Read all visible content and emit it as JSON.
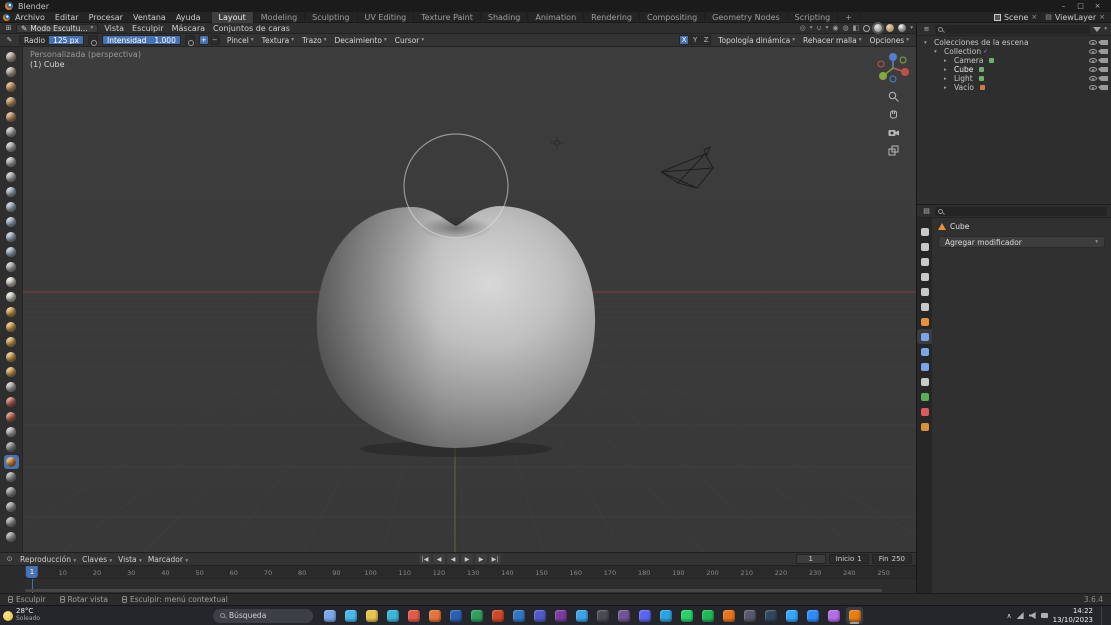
{
  "titlebar": {
    "app_name": "Blender",
    "controls": [
      {
        "n": "minimize",
        "g": "–"
      },
      {
        "n": "maximize",
        "g": "□"
      },
      {
        "n": "close",
        "g": "×"
      }
    ]
  },
  "topbar": {
    "menus": [
      "Archivo",
      "Editar",
      "Procesar",
      "Ventana",
      "Ayuda"
    ],
    "workspaces": [
      "Layout",
      "Modeling",
      "Sculpting",
      "UV Editing",
      "Texture Paint",
      "Shading",
      "Animation",
      "Rendering",
      "Compositing",
      "Geometry Nodes",
      "Scripting",
      "+"
    ],
    "active_workspace_index": 0,
    "scene_label": "Scene",
    "viewlayer_label": "ViewLayer"
  },
  "viewport_header": {
    "mode_label": "Modo Escultu...",
    "menus": [
      "Vista",
      "Esculpir",
      "Máscara",
      "Conjuntos de caras"
    ]
  },
  "tool_settings": {
    "radius_label": "Radio",
    "radius_value": "125 px",
    "strength_label": "Intensidad",
    "strength_value": "1.000",
    "direction_buttons": [
      "+",
      "−"
    ],
    "active_direction_index": 0,
    "dropdowns": [
      "Pincel",
      "Textura",
      "Trazo",
      "Decaimiento",
      "Cursor"
    ],
    "mirror_axes": [
      "X",
      "Y",
      "Z"
    ],
    "active_mirror_index": 0,
    "right_dropdowns": [
      "Topología dinámica",
      "Rehacer malla",
      "Opciones"
    ]
  },
  "viewport": {
    "view_label": "Personalizada (perspectiva)",
    "object_label": "(1) Cube",
    "active_brush_index": 27,
    "brushes": [
      {
        "n": "draw",
        "c": "#c2b6a8"
      },
      {
        "n": "draw-sharp",
        "c": "#bdb2a4"
      },
      {
        "n": "clay",
        "c": "#c79a66"
      },
      {
        "n": "clay-strips",
        "c": "#c79a66"
      },
      {
        "n": "clay-thumb",
        "c": "#c79a66"
      },
      {
        "n": "layer",
        "c": "#b8b8b8"
      },
      {
        "n": "inflate",
        "c": "#b8b8b8"
      },
      {
        "n": "blob",
        "c": "#b8b8b8"
      },
      {
        "n": "crease",
        "c": "#b8b8b8"
      },
      {
        "n": "smooth",
        "c": "#a8b8c8"
      },
      {
        "n": "flatten",
        "c": "#a8b8c8"
      },
      {
        "n": "fill",
        "c": "#a8b8c8"
      },
      {
        "n": "scrape",
        "c": "#a8b8c8"
      },
      {
        "n": "multiplane-scrape",
        "c": "#a8b8c8"
      },
      {
        "n": "pinch",
        "c": "#b8b8b8"
      },
      {
        "n": "grab",
        "c": "#e0dcd4"
      },
      {
        "n": "elastic-deform",
        "c": "#e0dcd4"
      },
      {
        "n": "snake-hook",
        "c": "#d9a758"
      },
      {
        "n": "thumb",
        "c": "#d9a758"
      },
      {
        "n": "pose",
        "c": "#d9a758"
      },
      {
        "n": "nudge",
        "c": "#d9a758"
      },
      {
        "n": "rotate",
        "c": "#d9a758"
      },
      {
        "n": "slide-relax",
        "c": "#b8b8b8"
      },
      {
        "n": "boundary",
        "c": "#c06a5a"
      },
      {
        "n": "cloth",
        "c": "#c06a5a"
      },
      {
        "n": "simplify",
        "c": "#b8b8b8"
      },
      {
        "n": "mask",
        "c": "#8f8f8f"
      },
      {
        "n": "draw-face-sets",
        "c": "#d98e3a"
      },
      {
        "n": "box-hide",
        "c": "#9f9f9f"
      },
      {
        "n": "box-mask",
        "c": "#9f9f9f"
      },
      {
        "n": "lasso-mask",
        "c": "#9f9f9f"
      },
      {
        "n": "line-project",
        "c": "#9f9f9f"
      },
      {
        "n": "mesh-filter",
        "c": "#9f9f9f"
      }
    ]
  },
  "outliner": {
    "rows": [
      {
        "label": "Colecciones de la escena",
        "icon": "scene",
        "depth": 0,
        "arrow": "▾"
      },
      {
        "label": "Collection",
        "icon": "collection",
        "depth": 1,
        "arrow": "▾",
        "check": "✓"
      },
      {
        "label": "Camera",
        "icon": "camera",
        "depth": 2,
        "arrow": "▸",
        "data_color": "#6fae6f"
      },
      {
        "label": "Cube",
        "icon": "mesh",
        "depth": 2,
        "arrow": "▸",
        "data_color": "#6fae6f",
        "tc": "#f2f2f2"
      },
      {
        "label": "Light",
        "icon": "light",
        "depth": 2,
        "arrow": "▸",
        "data_color": "#6fae6f"
      },
      {
        "label": "Vacío",
        "icon": "empty",
        "depth": 2,
        "arrow": "▸",
        "data_color": "#cf7a4a"
      }
    ]
  },
  "properties": {
    "active_tab_index": 7,
    "tabs": [
      {
        "n": "tool",
        "c": "#c8c8c8"
      },
      {
        "n": "render",
        "c": "#c8c8c8"
      },
      {
        "n": "output",
        "c": "#c8c8c8"
      },
      {
        "n": "view-layer",
        "c": "#c8c8c8"
      },
      {
        "n": "scene",
        "c": "#c8c8c8"
      },
      {
        "n": "world",
        "c": "#c8c8c8"
      },
      {
        "n": "object",
        "c": "#e8913c"
      },
      {
        "n": "modifiers",
        "c": "#7aa5e8"
      },
      {
        "n": "particles",
        "c": "#7aa5e8"
      },
      {
        "n": "physics",
        "c": "#7aa5e8"
      },
      {
        "n": "constraints",
        "c": "#c8c8c8"
      },
      {
        "n": "object-data",
        "c": "#58b058"
      },
      {
        "n": "material",
        "c": "#d95b5b"
      },
      {
        "n": "texture",
        "c": "#d98e3a"
      }
    ],
    "breadcrumb_object": "Cube",
    "add_modifier_label": "Agregar modificador"
  },
  "timeline": {
    "menus": [
      "Reproducción",
      "Claves",
      "Vista",
      "Marcador"
    ],
    "playback": [
      {
        "n": "jump-start",
        "g": "|◀"
      },
      {
        "n": "prev-keyframe",
        "g": "◀"
      },
      {
        "n": "play-reverse",
        "g": "◀"
      },
      {
        "n": "play",
        "g": "▶"
      },
      {
        "n": "next-keyframe",
        "g": "▶"
      },
      {
        "n": "jump-end",
        "g": "▶|"
      }
    ],
    "current_frame": "1",
    "start_label": "Inicio",
    "start_value": "1",
    "end_label": "Fin",
    "end_value": "250",
    "ticks": [
      10,
      20,
      30,
      40,
      50,
      60,
      70,
      80,
      90,
      100,
      110,
      120,
      130,
      140,
      150,
      160,
      170,
      180,
      190,
      200,
      210,
      220,
      230,
      240,
      250
    ]
  },
  "statusbar": {
    "hints": [
      "Esculpir",
      "Rotar vista",
      "Esculpir: menú contextual"
    ],
    "version": "3.6.4"
  },
  "taskbar": {
    "weather_temp": "28°C",
    "weather_desc": "Soleado",
    "search_placeholder": "Búsqueda",
    "active_app_index": 25,
    "apps": [
      {
        "n": "task-view",
        "c": "#7aa7e8"
      },
      {
        "n": "widgets",
        "c": "#49b6e8"
      },
      {
        "n": "file-explorer",
        "c": "#e8c44a"
      },
      {
        "n": "edge",
        "c": "#38b6d9"
      },
      {
        "n": "chrome",
        "c": "#e05a47"
      },
      {
        "n": "firefox",
        "c": "#e8733a"
      },
      {
        "n": "word",
        "c": "#2b5fb4"
      },
      {
        "n": "excel",
        "c": "#2e9e5b"
      },
      {
        "n": "powerpoint",
        "c": "#d04727"
      },
      {
        "n": "outlook",
        "c": "#2f76c4"
      },
      {
        "n": "teams",
        "c": "#5059c9"
      },
      {
        "n": "onenote",
        "c": "#7a3b9e"
      },
      {
        "n": "vscode",
        "c": "#3aa4e8"
      },
      {
        "n": "terminal",
        "c": "#4a4a52"
      },
      {
        "n": "github-desktop",
        "c": "#6e5494"
      },
      {
        "n": "discord",
        "c": "#5865f2"
      },
      {
        "n": "telegram",
        "c": "#2aa3e0"
      },
      {
        "n": "whatsapp",
        "c": "#25d366"
      },
      {
        "n": "spotify",
        "c": "#1db954"
      },
      {
        "n": "vlc",
        "c": "#e8731a"
      },
      {
        "n": "obs",
        "c": "#55586a"
      },
      {
        "n": "steam",
        "c": "#31465f"
      },
      {
        "n": "photoshop",
        "c": "#31a8ff"
      },
      {
        "n": "zoom",
        "c": "#2d8cff"
      },
      {
        "n": "krita",
        "c": "#b46be8"
      },
      {
        "n": "blender",
        "c": "#e87d0d"
      }
    ],
    "time": "14:22",
    "date": "13/10/2023"
  }
}
